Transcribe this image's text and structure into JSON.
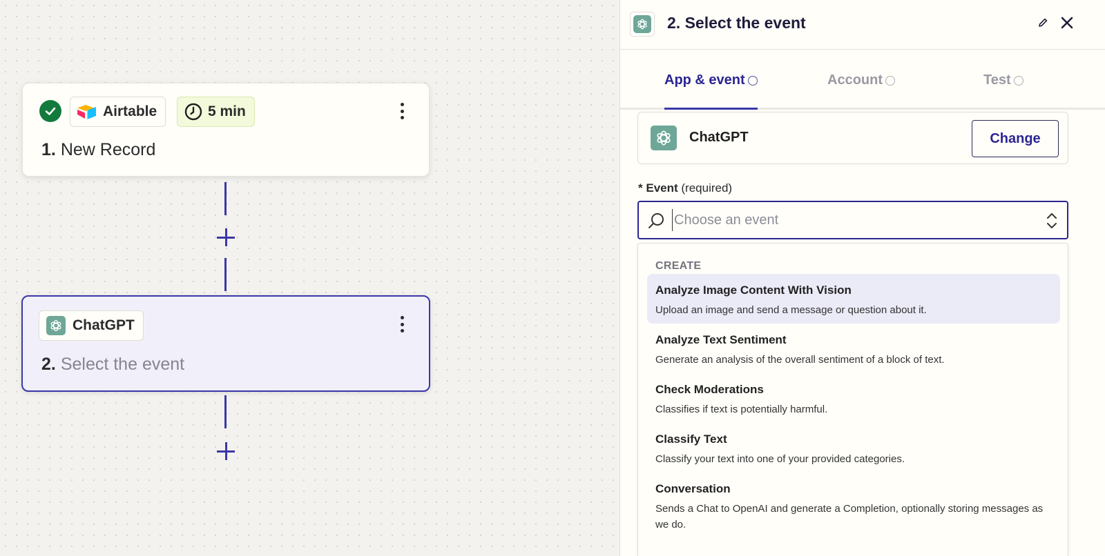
{
  "canvas": {
    "step1": {
      "app_name": "Airtable",
      "interval": "5 min",
      "number": "1.",
      "title": "New Record"
    },
    "step2": {
      "app_name": "ChatGPT",
      "number": "2.",
      "title": "Select the event"
    }
  },
  "panel": {
    "title": "2. Select the event",
    "tabs": [
      {
        "label": "App & event",
        "state": "active"
      },
      {
        "label": "Account",
        "state": "inactive"
      },
      {
        "label": "Test",
        "state": "inactive"
      }
    ],
    "app": {
      "name": "ChatGPT",
      "change_label": "Change"
    },
    "event_field": {
      "asterisk": "*",
      "label": "Event",
      "hint": "(required)",
      "placeholder": "Choose an event"
    },
    "dropdown": {
      "group": "CREATE",
      "options": [
        {
          "title": "Analyze Image Content With Vision",
          "description": "Upload an image and send a message or question about it."
        },
        {
          "title": "Analyze Text Sentiment",
          "description": "Generate an analysis of the overall sentiment of a block of text."
        },
        {
          "title": "Check Moderations",
          "description": "Classifies if text is potentially harmful."
        },
        {
          "title": "Classify Text",
          "description": "Classify your text into one of your provided categories."
        },
        {
          "title": "Conversation",
          "description": "Sends a Chat to OpenAI and generate a Completion, optionally storing messages as we do."
        }
      ]
    }
  },
  "colors": {
    "accent": "#3b37a8",
    "success": "#137a3d",
    "chatgpt": "#6ea797"
  }
}
